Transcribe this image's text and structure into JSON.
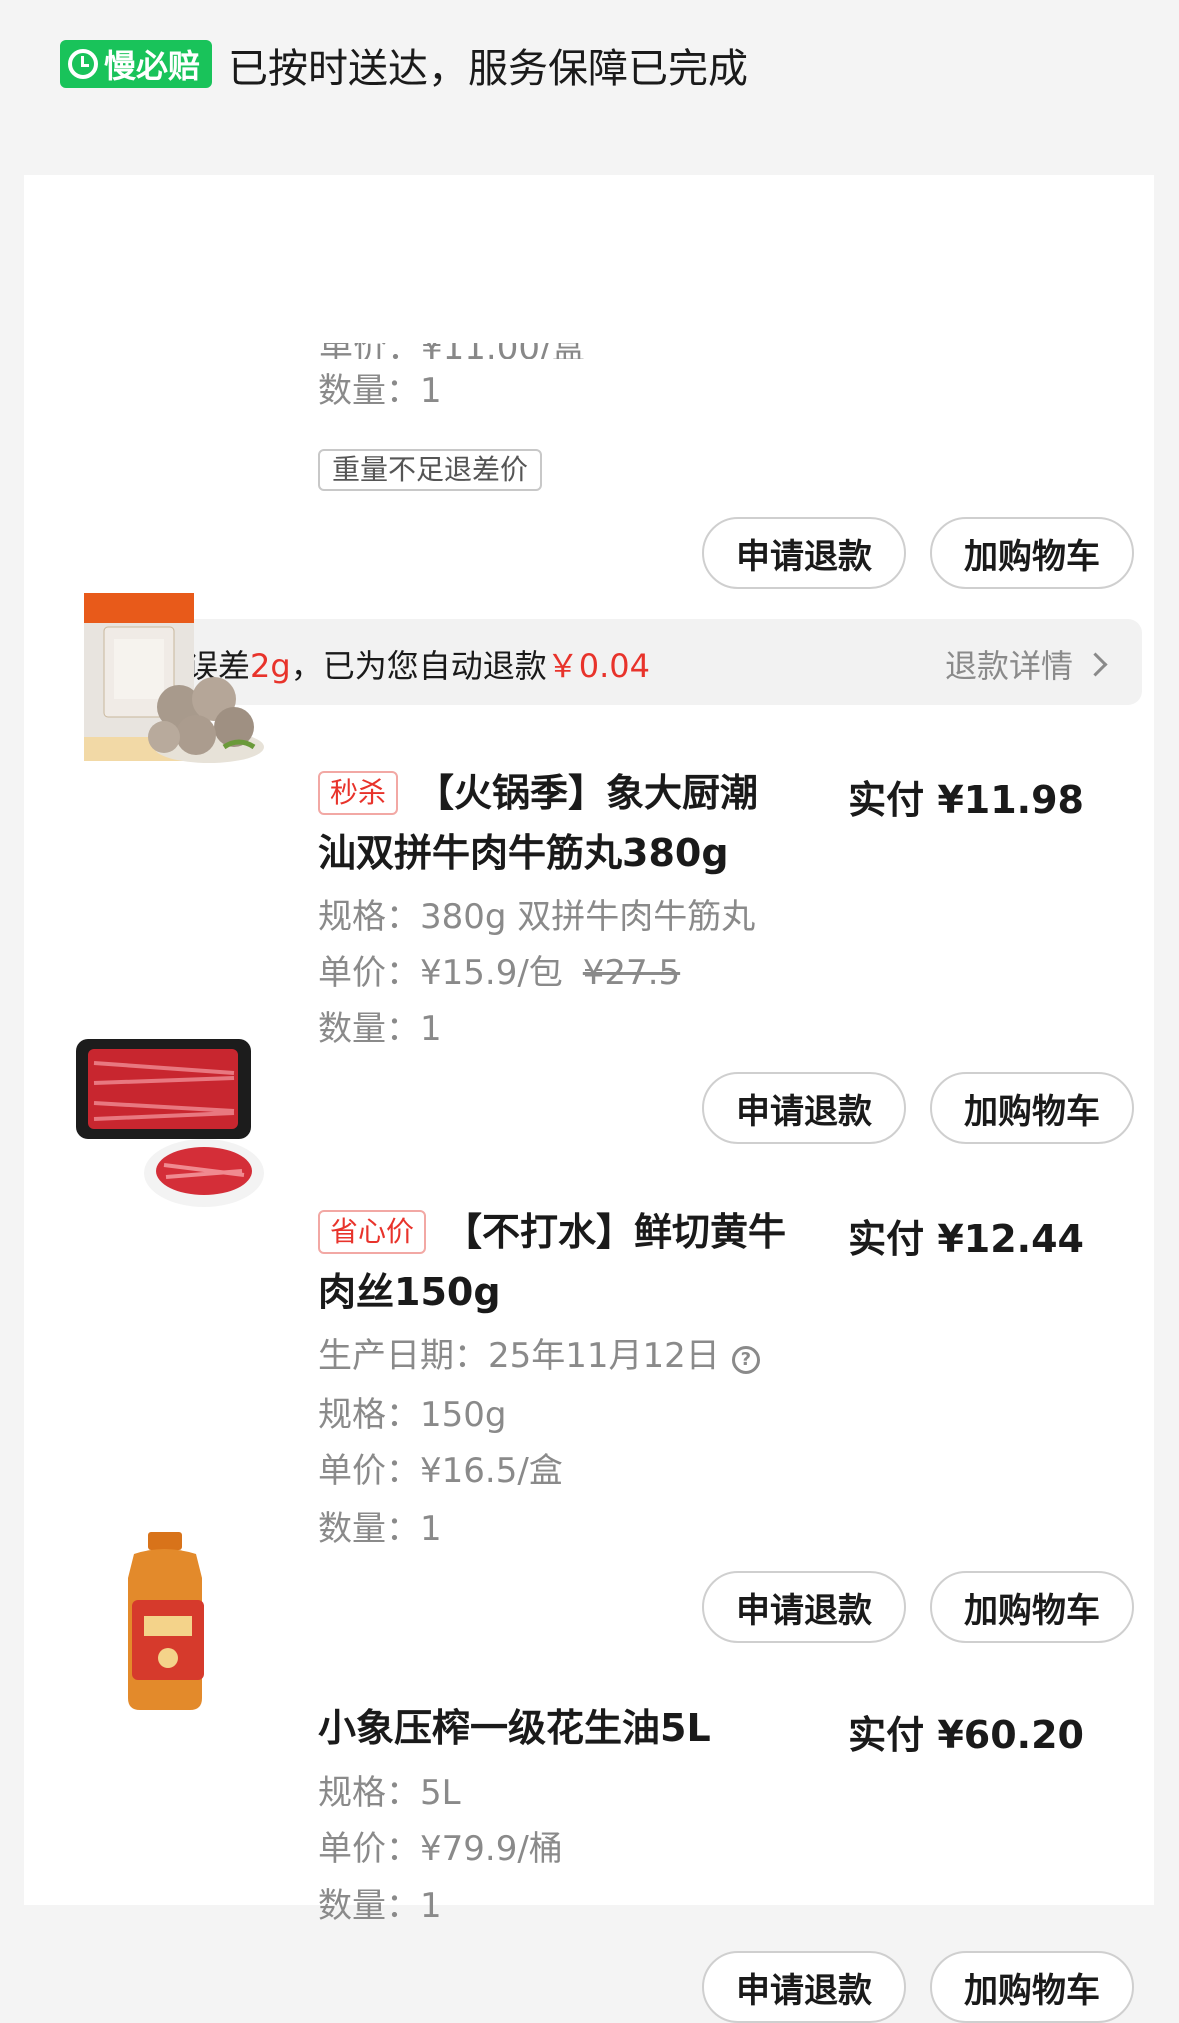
{
  "header": {
    "badge_label": "慢必赔",
    "status_text": "已按时送达，服务保障已完成",
    "badge_color": "#19c35a"
  },
  "item0": {
    "qty_label": "数量：",
    "qty": "1",
    "tag": "重量不足退差价",
    "refund_btn": "申请退款",
    "cart_btn": "加购物车"
  },
  "refund_note": {
    "prefix": "重量误差",
    "weight": "2g",
    "middle": "，已为您自动退款",
    "amount": "￥0.04",
    "detail_link": "退款详情"
  },
  "items": [
    {
      "promo": "秒杀",
      "title": "【火锅季】象大厨潮汕双拼牛肉牛筋丸380g",
      "paid": "实付 ¥11.98",
      "spec_label": "规格：",
      "spec": "380g 双拼牛肉牛筋丸",
      "price_label": "单价：",
      "price": "¥15.9/包",
      "orig_price": "¥27.5",
      "qty_label": "数量：",
      "qty": "1",
      "refund_btn": "申请退款",
      "cart_btn": "加购物车",
      "image_icon": "beef-balls-package-image"
    },
    {
      "promo": "省心价",
      "title": "【不打水】鲜切黄牛肉丝150g",
      "paid": "实付 ¥12.44",
      "date_label": "生产日期：",
      "date": "25年11月12日",
      "spec_label": "规格：",
      "spec": "150g",
      "price_label": "单价：",
      "price": "¥16.5/盒",
      "qty_label": "数量：",
      "qty": "1",
      "refund_btn": "申请退款",
      "cart_btn": "加购物车",
      "image_icon": "sliced-beef-tray-image"
    },
    {
      "title": "小象压榨一级花生油5L",
      "paid": "实付 ¥60.20",
      "spec_label": "规格：",
      "spec": "5L",
      "price_label": "单价：",
      "price": "¥79.9/桶",
      "qty_label": "数量：",
      "qty": "1",
      "refund_btn": "申请退款",
      "cart_btn": "加购物车",
      "image_icon": "peanut-oil-bottle-image"
    }
  ],
  "colors": {
    "accent_red": "#e8332b",
    "muted_text": "#8a8a8a"
  }
}
